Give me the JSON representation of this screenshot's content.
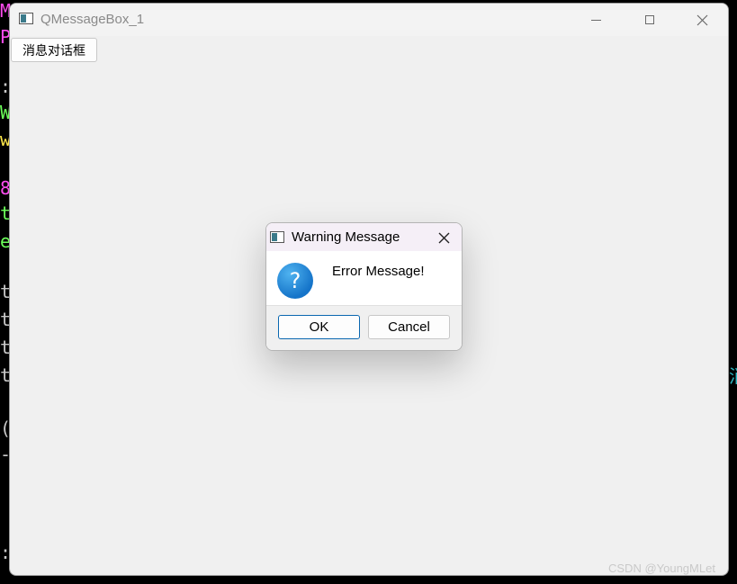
{
  "terminal": {
    "lines": [
      {
        "text": "M",
        "color": "#ff4df0"
      },
      {
        "text": "P",
        "color": "#ff4df0"
      },
      {
        "text": ":",
        "color": "#c8c8c8"
      },
      {
        "text": "W",
        "color": "#6cff5a"
      },
      {
        "text": "w",
        "color": "#ffe84a"
      },
      {
        "text": "8",
        "color": "#ff4df0"
      },
      {
        "text": "t",
        "color": "#6cff5a"
      },
      {
        "text": "e",
        "color": "#6cff5a"
      },
      {
        "text": "t",
        "color": "#c8c8c8"
      },
      {
        "text": "t",
        "color": "#c8c8c8"
      },
      {
        "text": "t",
        "color": "#c8c8c8"
      },
      {
        "text": "t",
        "color": "#c8c8c8"
      },
      {
        "text": "(",
        "color": "#c8c8c8"
      },
      {
        "text": "-",
        "color": "#c8c8c8"
      },
      {
        "text": ":",
        "color": "#c8c8c8"
      }
    ],
    "right_glyph": "消"
  },
  "window": {
    "title": "QMessageBox_1",
    "open_button_label": "消息对话框"
  },
  "dialog": {
    "title": "Warning Message",
    "message": "Error Message!",
    "icon": "question-icon",
    "ok_label": "OK",
    "cancel_label": "Cancel"
  },
  "watermark": "CSDN @YoungMLet"
}
